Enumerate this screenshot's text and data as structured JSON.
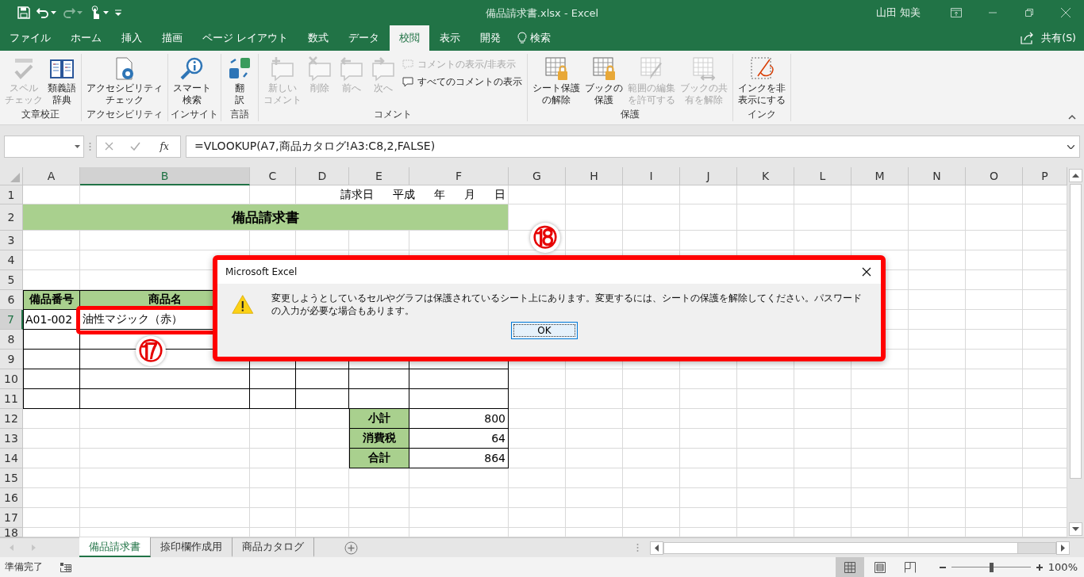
{
  "title_bar": {
    "document_title": "備品請求書.xlsx  -  Excel",
    "user": "山田 知美"
  },
  "menu_tabs": [
    {
      "label": "ファイル",
      "selected": false
    },
    {
      "label": "ホーム",
      "selected": false
    },
    {
      "label": "挿入",
      "selected": false
    },
    {
      "label": "描画",
      "selected": false
    },
    {
      "label": "ページ レイアウト",
      "selected": false
    },
    {
      "label": "数式",
      "selected": false
    },
    {
      "label": "データ",
      "selected": false
    },
    {
      "label": "校閲",
      "selected": true
    },
    {
      "label": "表示",
      "selected": false
    },
    {
      "label": "開発",
      "selected": false
    }
  ],
  "tell_me": "検索",
  "share": "共有(S)",
  "ribbon": {
    "groups": [
      {
        "label": "文章校正",
        "buttons": [
          {
            "kind": "large",
            "label": "スペルチェック",
            "disabled": true
          },
          {
            "kind": "large",
            "label": "類義語辞典",
            "disabled": false
          }
        ]
      },
      {
        "label": "アクセシビリティ",
        "buttons": [
          {
            "kind": "large",
            "label": "アクセシビリティチェック",
            "disabled": false
          }
        ]
      },
      {
        "label": "インサイト",
        "buttons": [
          {
            "kind": "large",
            "label": "スマート検索",
            "disabled": false
          }
        ]
      },
      {
        "label": "言語",
        "buttons": [
          {
            "kind": "large",
            "label": "翻訳",
            "disabled": false
          }
        ]
      },
      {
        "label": "コメント",
        "buttons": [
          {
            "kind": "large",
            "label": "新しいコメント",
            "disabled": true
          },
          {
            "kind": "large",
            "label": "削除",
            "disabled": true
          },
          {
            "kind": "large",
            "label": "前へ",
            "disabled": true
          },
          {
            "kind": "large",
            "label": "次へ",
            "disabled": true
          },
          {
            "kind": "small",
            "label": "コメントの表示/非表示",
            "disabled": true
          },
          {
            "kind": "small",
            "label": "すべてのコメントの表示",
            "disabled": false
          }
        ]
      },
      {
        "label": "保護",
        "buttons": [
          {
            "kind": "large",
            "label": "シート保護の解除",
            "disabled": false
          },
          {
            "kind": "large",
            "label": "ブックの保護",
            "disabled": false
          },
          {
            "kind": "large",
            "label": "範囲の編集を許可する",
            "disabled": true
          },
          {
            "kind": "large",
            "label": "ブックの共有を解除",
            "disabled": true
          }
        ]
      },
      {
        "label": "インク",
        "buttons": [
          {
            "kind": "large",
            "label": "インクを非表示にする",
            "disabled": false
          }
        ]
      }
    ]
  },
  "formula_bar": {
    "function_label": "fx",
    "formula": "=VLOOKUP(A7,商品カタログ!A3:C8,2,FALSE)"
  },
  "sheet": {
    "columns": [
      {
        "label": "A",
        "selected": false
      },
      {
        "label": "B",
        "selected": true
      },
      {
        "label": "C",
        "selected": false
      },
      {
        "label": "D",
        "selected": false
      },
      {
        "label": "E",
        "selected": false
      },
      {
        "label": "F",
        "selected": false
      },
      {
        "label": "G",
        "selected": false
      },
      {
        "label": "H",
        "selected": false
      },
      {
        "label": "I",
        "selected": false
      },
      {
        "label": "J",
        "selected": false
      },
      {
        "label": "K",
        "selected": false
      },
      {
        "label": "L",
        "selected": false
      },
      {
        "label": "M",
        "selected": false
      },
      {
        "label": "N",
        "selected": false
      },
      {
        "label": "O",
        "selected": false
      },
      {
        "label": "P",
        "selected": false
      }
    ],
    "rows": [
      {
        "label": "1",
        "selected": false
      },
      {
        "label": "2",
        "selected": false
      },
      {
        "label": "3",
        "selected": false
      },
      {
        "label": "4",
        "selected": false
      },
      {
        "label": "5",
        "selected": false
      },
      {
        "label": "6",
        "selected": false
      },
      {
        "label": "7",
        "selected": true
      },
      {
        "label": "8",
        "selected": false
      },
      {
        "label": "9",
        "selected": false
      },
      {
        "label": "10",
        "selected": false
      },
      {
        "label": "11",
        "selected": false
      },
      {
        "label": "12",
        "selected": false
      },
      {
        "label": "13",
        "selected": false
      },
      {
        "label": "14",
        "selected": false
      },
      {
        "label": "15",
        "selected": false
      },
      {
        "label": "16",
        "selected": false
      },
      {
        "label": "17",
        "selected": false
      },
      {
        "label": "18",
        "selected": false
      }
    ],
    "date_line": [
      "請求日",
      "平成",
      "年",
      "月",
      "日"
    ],
    "title": "備品請求書",
    "table_headers": [
      "備品番号",
      "商品名"
    ],
    "item": {
      "code": "A01-002",
      "name": "油性マジック（赤）"
    },
    "totals": [
      {
        "label": "小計",
        "value": "800"
      },
      {
        "label": "消費税",
        "value": "64"
      },
      {
        "label": "合計",
        "value": "864"
      }
    ]
  },
  "sheet_tabs": [
    {
      "label": "備品請求書",
      "selected": true
    },
    {
      "label": "捺印欄作成用",
      "selected": false
    },
    {
      "label": "商品カタログ",
      "selected": false
    }
  ],
  "status_bar": {
    "status": "準備完了",
    "views": [
      {
        "selected": true
      },
      {
        "selected": false
      },
      {
        "selected": false
      }
    ],
    "zoom": {
      "level": 0.5,
      "reading": "100%"
    }
  },
  "dialog": {
    "title": "Microsoft Excel",
    "message": "変更しようとしているセルやグラフは保護されているシート上にあります。変更するには、シートの保護を解除してください。パスワードの入力が必要な場合もあります。",
    "button": "OK"
  },
  "annotations": [
    "⑰",
    "⑱"
  ]
}
